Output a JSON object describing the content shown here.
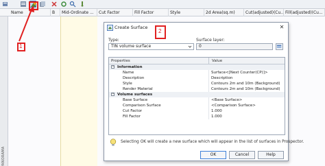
{
  "columns": [
    "Name",
    "B",
    "Mid-Ordinate ...",
    "Cut Factor",
    "Fill Factor",
    "Style",
    "2d Area(sq.m)",
    "Cut(adjusted)(Cu...",
    "Fill(adjusted)(Cu..."
  ],
  "left_panel_label": "PANORAMA",
  "callouts": {
    "one": "1",
    "two": "2"
  },
  "dialog": {
    "title": "Create Surface",
    "type_label": "Type:",
    "type_value": "TIN volume surface",
    "layer_label": "Surface layer:",
    "layer_value": "0",
    "grid_headers": {
      "properties": "Properties",
      "value": "Value"
    },
    "categories": [
      {
        "label": "Information",
        "rows": [
          {
            "key": "Name",
            "value": "Surface<[Next Counter(CP)]>"
          },
          {
            "key": "Description",
            "value": "Description"
          },
          {
            "key": "Style",
            "value": "Contours 2m and 10m (Background)"
          },
          {
            "key": "Render Material",
            "value": "Contours 2m and 10m (Background)"
          }
        ]
      },
      {
        "label": "Volume surfaces",
        "rows": [
          {
            "key": "Base Surface",
            "value": "<Base Surface>"
          },
          {
            "key": "Comparison Surface",
            "value": "<Comparison Surface>"
          },
          {
            "key": "Cut Factor",
            "value": "1.000"
          },
          {
            "key": "Fill Factor",
            "value": "1.000"
          }
        ]
      }
    ],
    "notice": "Selecting OK will create a new surface which will appear in the list of surfaces in Prospector.",
    "buttons": {
      "ok": "OK",
      "cancel": "Cancel",
      "help": "Help"
    }
  },
  "colors": {
    "callout": "#e02020",
    "accent": "#3c7fd9",
    "stripe": "#fffbe6"
  },
  "icons": [
    "create-surface-icon",
    "close-icon",
    "chevron-down-icon",
    "layer-picker-icon",
    "lightbulb-icon"
  ]
}
